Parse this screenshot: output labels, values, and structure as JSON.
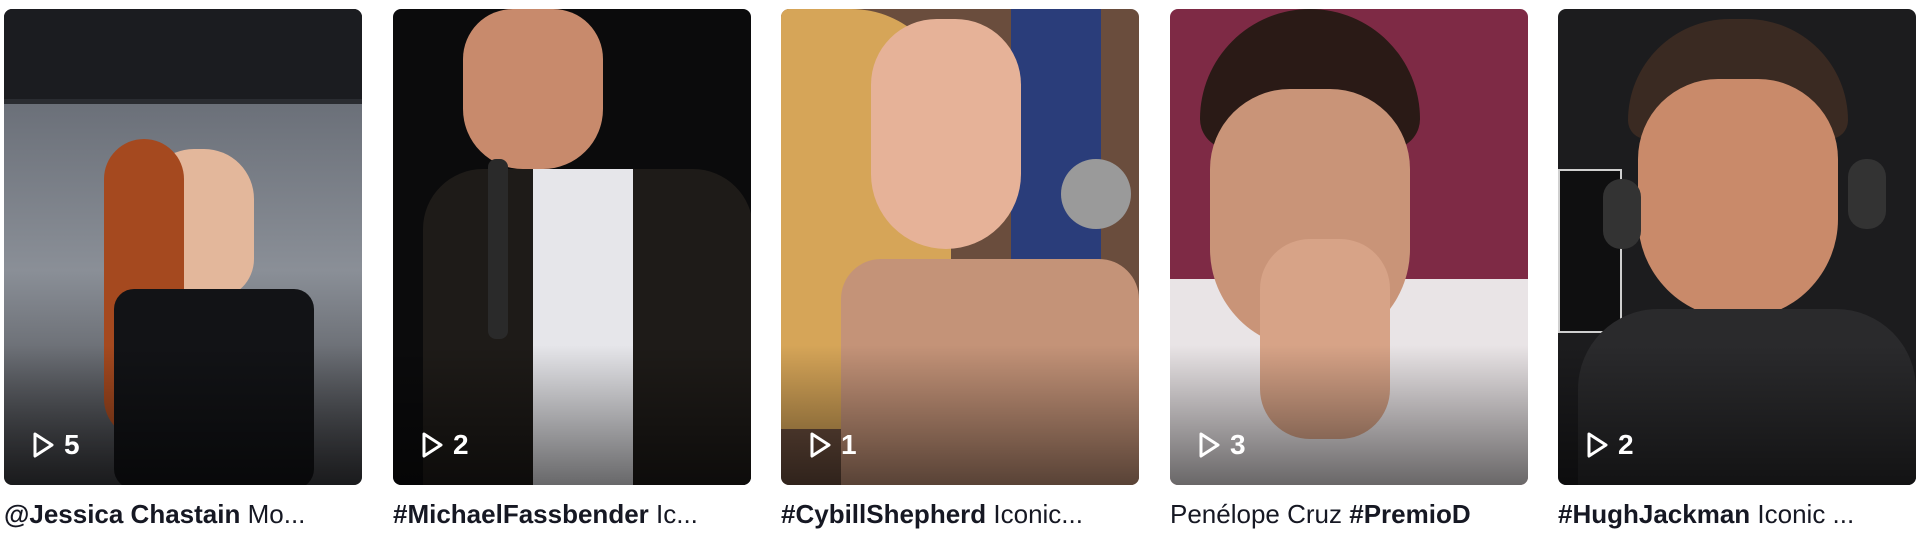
{
  "videos": [
    {
      "views": "5",
      "caption_bold": "@Jessica Chastain",
      "caption_rest": " Mo...",
      "colors": {
        "bg": "#5d6268",
        "accent": "#b0532a",
        "dark": "#15161a"
      }
    },
    {
      "views": "2",
      "caption_bold": "#MichaelFassbender",
      "caption_rest": " Ic...",
      "colors": {
        "bg": "#0b0b0c",
        "accent": "#c98a6a",
        "dark": "#1e1b18"
      }
    },
    {
      "views": "1",
      "caption_bold": "#CybillShepherd",
      "caption_rest": " Iconic...",
      "colors": {
        "bg": "#6a4d3d",
        "accent": "#d8a85a",
        "dark": "#2a3d7a"
      }
    },
    {
      "caption_pre": "Penélope Cruz ",
      "views": "3",
      "caption_bold": "#PremioD",
      "caption_rest": "",
      "colors": {
        "bg": "#7e2a45",
        "accent": "#c99478",
        "dark": "#2a1a16"
      }
    },
    {
      "views": "2",
      "caption_bold": "#HughJackman",
      "caption_rest": " Iconic ...",
      "colors": {
        "bg": "#1c1c1e",
        "accent": "#c98a6a",
        "dark": "#2a2a2c"
      }
    }
  ]
}
